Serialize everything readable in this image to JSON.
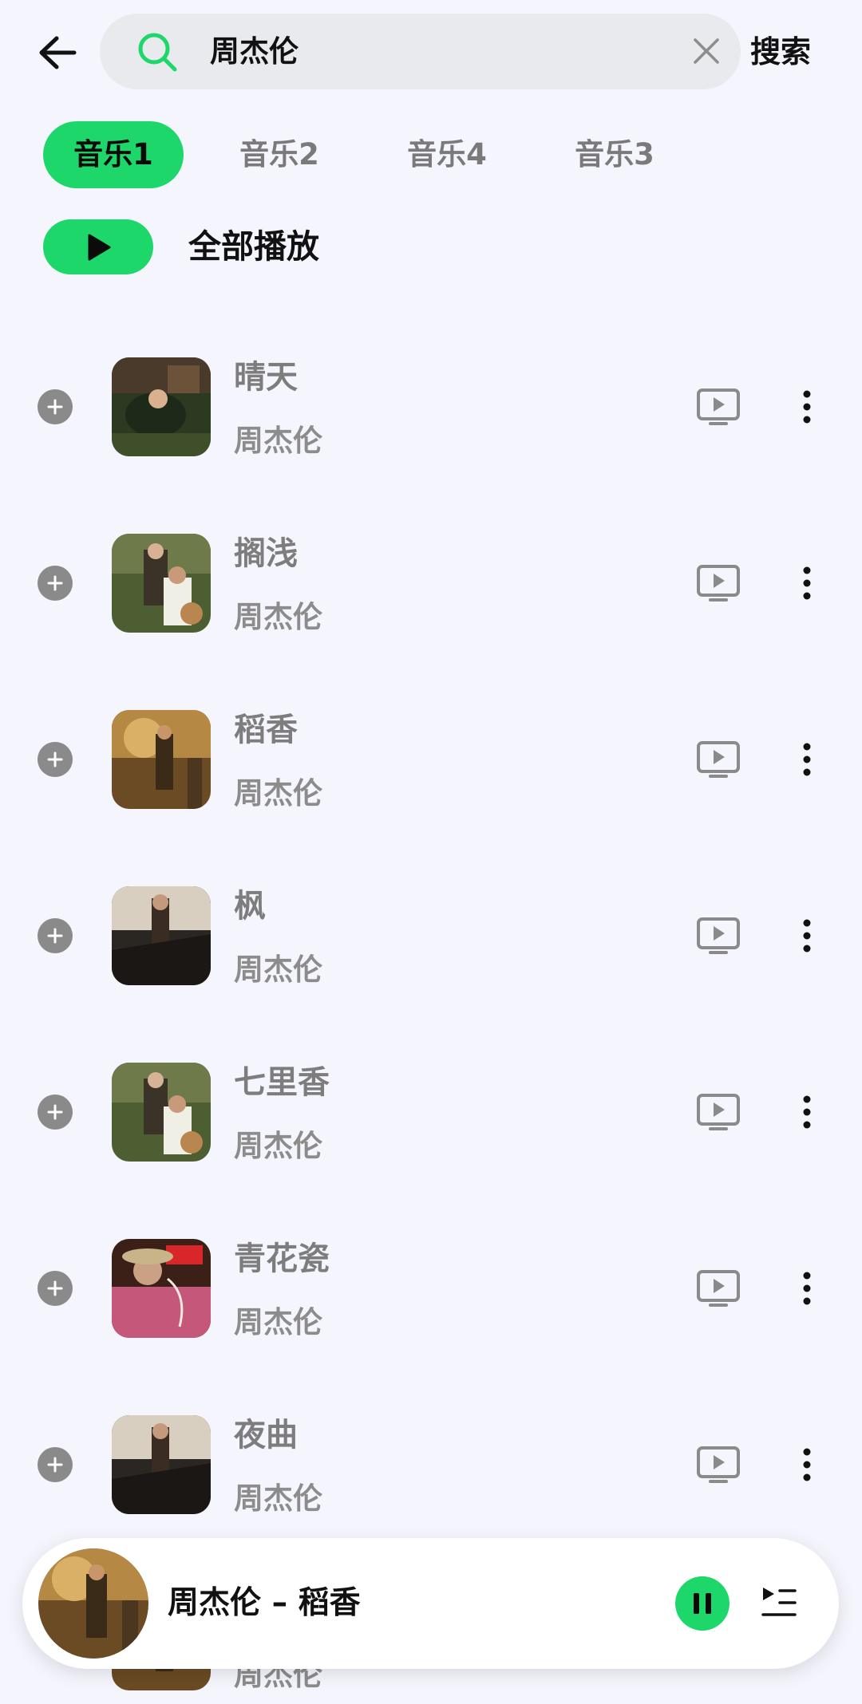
{
  "header": {
    "back_icon": "arrow-left-icon",
    "search_icon": "search-icon",
    "search_query": "周杰伦",
    "clear_icon": "close-icon",
    "search_button_label": "搜索"
  },
  "tabs": [
    {
      "label": "音乐1",
      "active": true
    },
    {
      "label": "音乐2",
      "active": false
    },
    {
      "label": "音乐4",
      "active": false
    },
    {
      "label": "音乐3",
      "active": false
    }
  ],
  "play_all": {
    "label": "全部播放",
    "icon": "play-icon"
  },
  "songs": [
    {
      "title": "晴天",
      "artist": "周杰伦"
    },
    {
      "title": "搁浅",
      "artist": "周杰伦"
    },
    {
      "title": "稻香",
      "artist": "周杰伦"
    },
    {
      "title": "枫",
      "artist": "周杰伦"
    },
    {
      "title": "七里香",
      "artist": "周杰伦"
    },
    {
      "title": "青花瓷",
      "artist": "周杰伦"
    },
    {
      "title": "夜曲",
      "artist": "周杰伦"
    },
    {
      "title": "",
      "artist": "周杰伦"
    }
  ],
  "row_icons": {
    "add": "plus-circle-icon",
    "mv": "video-play-icon",
    "more": "more-vertical-icon"
  },
  "mini_player": {
    "now_playing": "周杰伦 – 稻香",
    "pause_icon": "pause-icon",
    "queue_icon": "playlist-icon"
  },
  "colors": {
    "accent": "#1ed76a",
    "background": "#f5f6fd",
    "search_bg": "#e8eaee",
    "muted_text": "#7d7d7d"
  }
}
